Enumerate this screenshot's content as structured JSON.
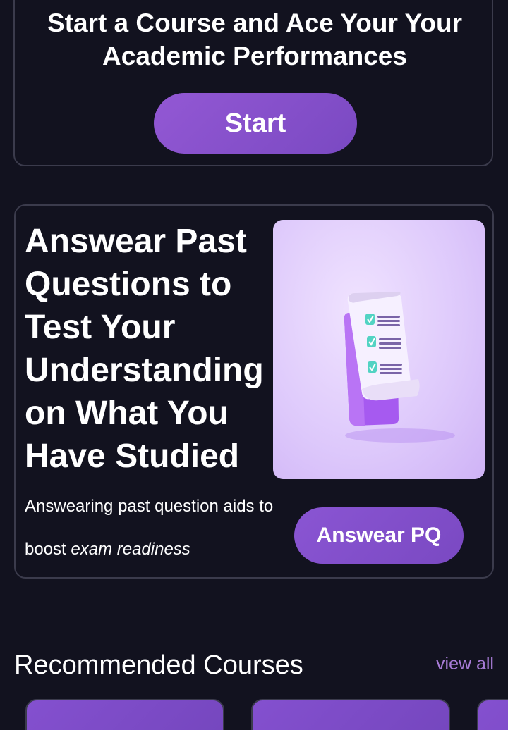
{
  "hero": {
    "title": "Start a Course and Ace Your Your Academic Performances",
    "start_label": "Start"
  },
  "past_questions": {
    "title": "Answear Past Questions to Test Your Understanding on What You Have Studied",
    "description_plain": "Answearing past question aids to boost ",
    "description_italic": "exam readiness",
    "button_label": "Answear PQ",
    "illustration": "checklist-scroll-illustration"
  },
  "recommended": {
    "title": "Recommended Courses",
    "view_all_label": "view all",
    "courses": [
      {},
      {},
      {}
    ]
  },
  "colors": {
    "background": "#12121f",
    "accent": "#7e4ccb",
    "link": "#a77bd6",
    "border": "#3b3b4c"
  }
}
